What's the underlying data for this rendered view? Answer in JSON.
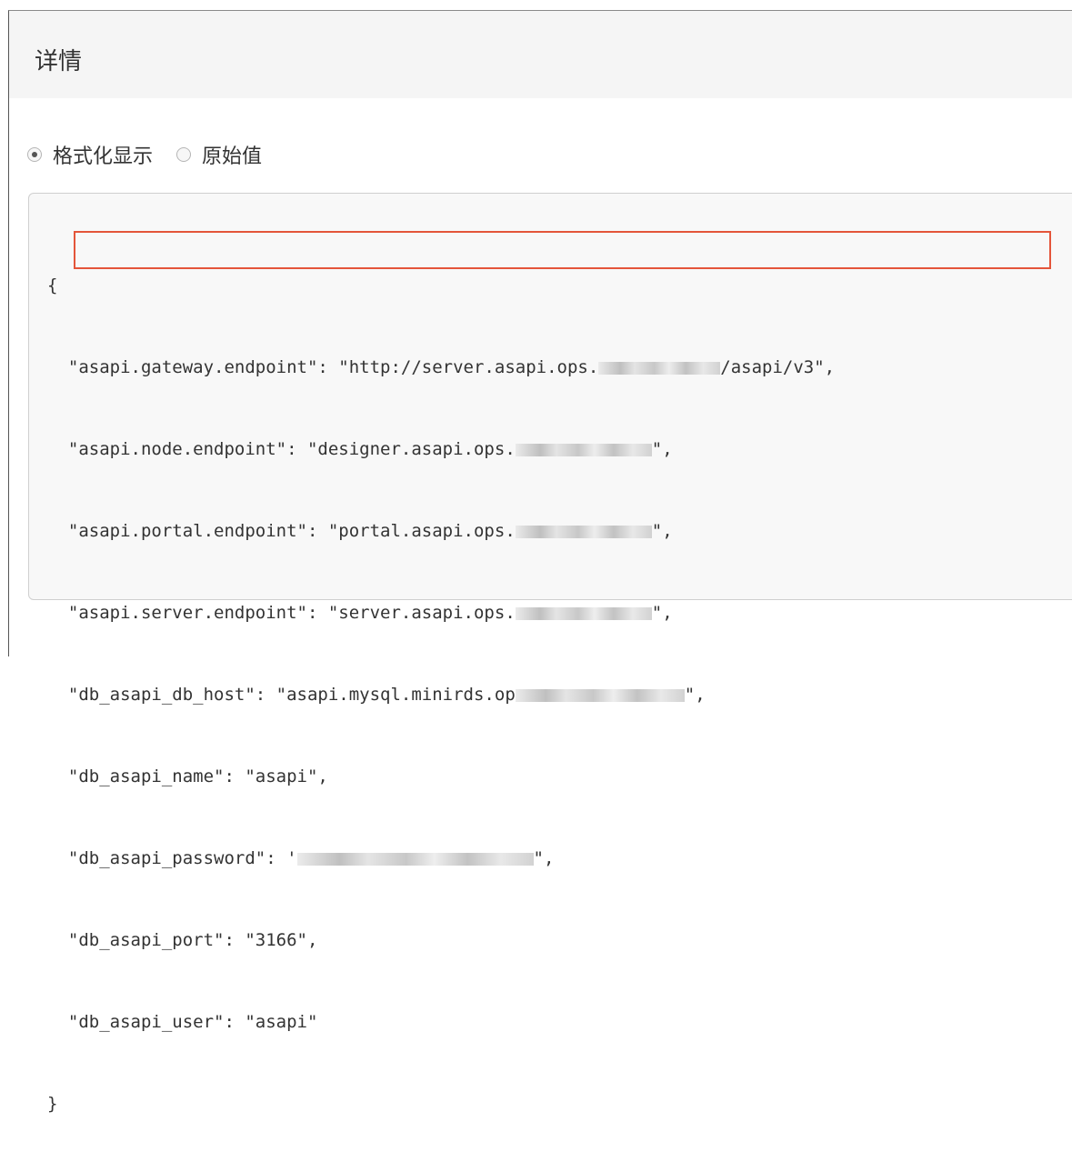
{
  "header": {
    "title": "详情"
  },
  "display_mode": {
    "options": [
      {
        "label": "格式化显示",
        "selected": true
      },
      {
        "label": "原始值",
        "selected": false
      }
    ]
  },
  "code": {
    "open_brace": "{",
    "close_brace": "}",
    "lines": [
      {
        "text_before": "  \"asapi.gateway.endpoint\": \"http://server.asapi.ops.",
        "text_after": "/asapi/v3\","
      },
      {
        "text_before": "  \"asapi.node.endpoint\": \"designer.asapi.ops.",
        "text_after": "\","
      },
      {
        "text_before": "  \"asapi.portal.endpoint\": \"portal.asapi.ops.",
        "text_after": "\","
      },
      {
        "text_before": "  \"asapi.server.endpoint\": \"server.asapi.ops.",
        "text_after": "\","
      },
      {
        "text_before": "  \"db_asapi_db_host\": \"asapi.mysql.minirds.op",
        "text_after": "\","
      },
      {
        "text_before": "  \"db_asapi_name\": \"asapi\",",
        "text_after": ""
      },
      {
        "text_before": "  \"db_asapi_password\": '",
        "text_after": "\","
      },
      {
        "text_before": "  \"db_asapi_port\": \"3166\",",
        "text_after": ""
      },
      {
        "text_before": "  \"db_asapi_user\": \"asapi\"",
        "text_after": ""
      }
    ]
  },
  "colors": {
    "highlight_border": "#e4553a",
    "header_background": "#f5f5f5",
    "code_background": "#f8f8f8"
  }
}
